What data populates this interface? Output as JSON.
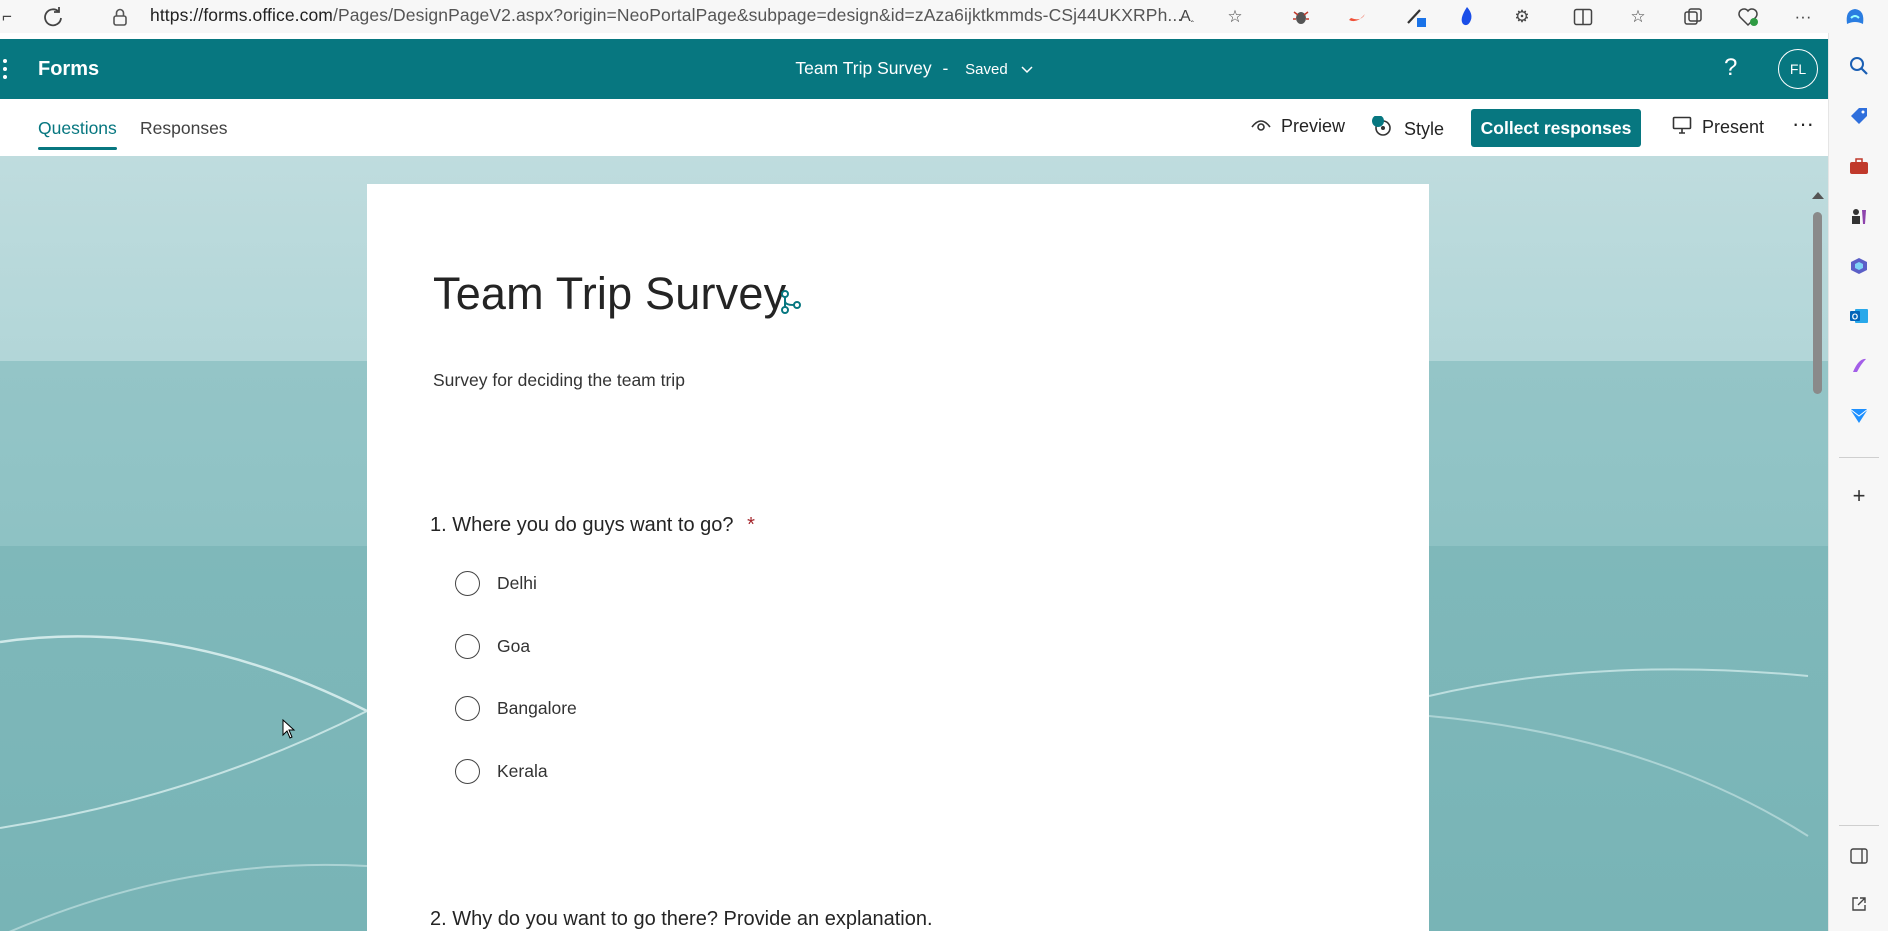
{
  "browser": {
    "url_domain": "https://forms.office.com",
    "url_path": "/Pages/DesignPageV2.aspx?origin=NeoPortalPage&subpage=design&id=zAza6ijktkmmds-CSj44UKXRPh..."
  },
  "header": {
    "app_name": "Forms",
    "form_title": "Team Trip Survey",
    "separator": "-",
    "save_status": "Saved",
    "help_label": "?",
    "avatar_initials": "FL"
  },
  "tabs": {
    "questions": "Questions",
    "responses": "Responses"
  },
  "toolbar": {
    "preview": "Preview",
    "style": "Style",
    "collect": "Collect responses",
    "present": "Present",
    "more": "···"
  },
  "form": {
    "title": "Team Trip Survey",
    "description": "Survey for deciding the team trip",
    "questions": [
      {
        "number": "1.",
        "text": "Where you do guys want to go?",
        "required_mark": "*",
        "options": [
          "Delhi",
          "Goa",
          "Bangalore",
          "Kerala"
        ]
      },
      {
        "number": "2.",
        "text": "Why do you want to go there? Provide an explanation."
      }
    ]
  },
  "colors": {
    "brand": "#077780",
    "required": "#a4262c"
  }
}
